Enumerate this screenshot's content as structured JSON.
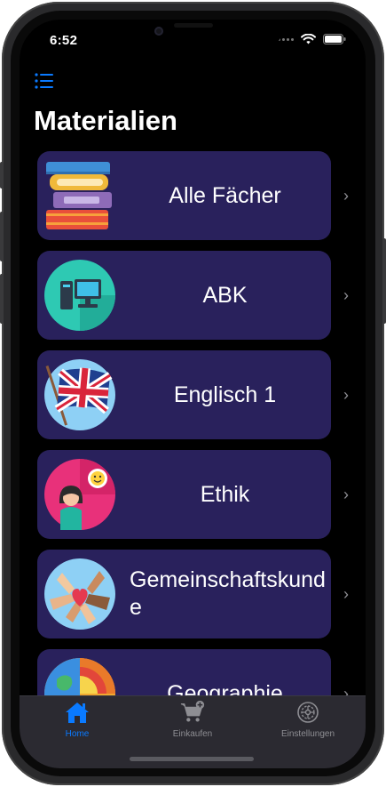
{
  "status_bar": {
    "time": "6:52"
  },
  "header": {
    "title": "Materialien"
  },
  "list": {
    "items": [
      {
        "label": "Alle Fächer",
        "icon": "books-icon"
      },
      {
        "label": "ABK",
        "icon": "computer-icon"
      },
      {
        "label": "Englisch 1",
        "icon": "uk-flag-icon"
      },
      {
        "label": "Ethik",
        "icon": "person-emoji-icon"
      },
      {
        "label": "Gemeinschaftskunde",
        "icon": "community-hands-icon"
      },
      {
        "label": "Geographie",
        "icon": "globe-icon"
      }
    ]
  },
  "tabbar": {
    "tabs": [
      {
        "label": "Home",
        "icon": "house-icon",
        "active": true
      },
      {
        "label": "Einkaufen",
        "icon": "cart-icon",
        "active": false
      },
      {
        "label": "Einstellungen",
        "icon": "gear-icon",
        "active": false
      }
    ]
  },
  "colors": {
    "card_background": "#29215c",
    "accent": "#0a7aff",
    "background": "#000000",
    "tabbar_background": "#2b2a31"
  }
}
